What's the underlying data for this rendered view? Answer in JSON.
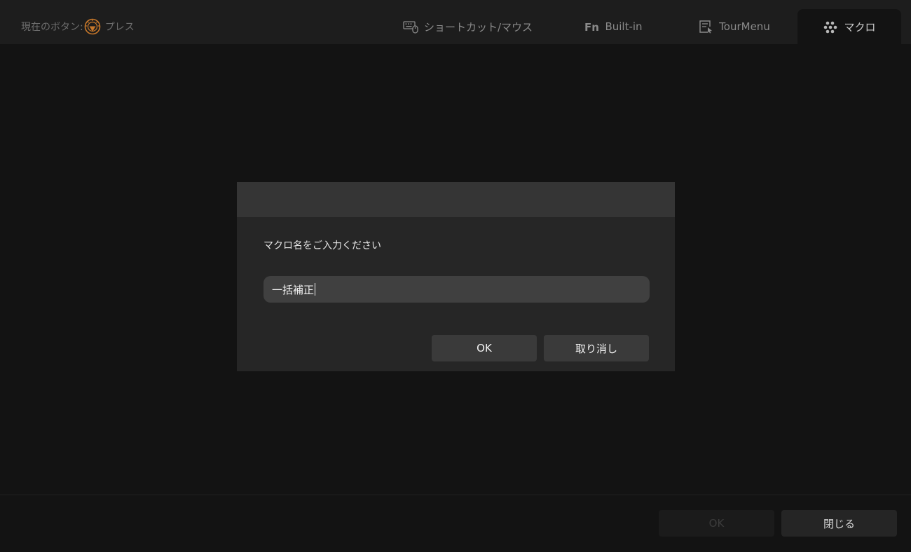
{
  "header": {
    "current_button_label": "現在のボタン:",
    "current_button_action": "プレス",
    "tabs": [
      {
        "label": "ショートカット/マウス",
        "icon": "keyboard-mouse-icon",
        "active": false
      },
      {
        "label": "Built-in",
        "icon": "fn-icon",
        "active": false
      },
      {
        "label": "TourMenu",
        "icon": "tourmenu-icon",
        "active": false
      },
      {
        "label": "マクロ",
        "icon": "macro-dots-icon",
        "active": true
      }
    ]
  },
  "dialog": {
    "prompt": "マクロ名をご入力ください",
    "input_value": "一括補正",
    "ok_label": "OK",
    "cancel_label": "取り消し"
  },
  "footer": {
    "ok_label": "OK",
    "close_label": "閉じる",
    "ok_enabled": false
  },
  "colors": {
    "accent_dial": "#c8782a",
    "background": "#131313",
    "header": "#1d1d1d",
    "dialog": "#262626",
    "dialog_title": "#353535"
  }
}
